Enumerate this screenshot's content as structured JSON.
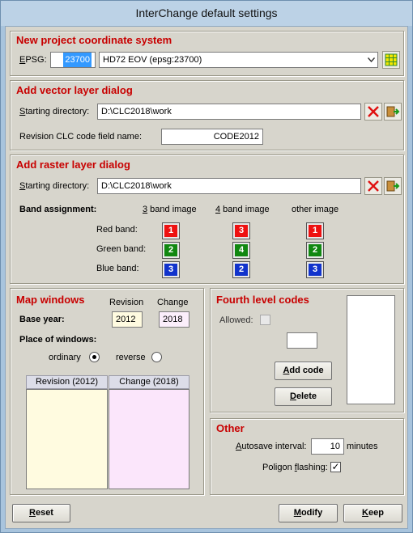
{
  "window": {
    "title": "InterChange default settings"
  },
  "project": {
    "title": "New project coordinate system",
    "epsg_prefix": "E",
    "epsg_rest": "PSG:",
    "epsg_value": "23700",
    "crs_selected": "HD72 EOV (epsg:23700)",
    "icons": {
      "grid": "grid-icon",
      "dropdown": "chevron-down-icon"
    }
  },
  "vector": {
    "title": "Add vector layer dialog",
    "start_dir_prefix": "S",
    "start_dir_rest": "tarting directory:",
    "start_dir_value": "D:\\CLC2018\\work",
    "field_label": "Revision CLC code field name:",
    "field_value": "CODE2012"
  },
  "raster": {
    "title": "Add raster layer dialog",
    "start_dir_prefix": "S",
    "start_dir_rest": "tarting directory:",
    "start_dir_value": "D:\\CLC2018\\work",
    "band_assignment": "Band assignment:",
    "columns": [
      {
        "ul": "3",
        "rest": " band image"
      },
      {
        "ul": "4",
        "rest": " band image"
      },
      {
        "ul": "",
        "rest": "other image"
      }
    ],
    "rows": [
      {
        "label": "Red band:",
        "values": [
          "1",
          "3",
          "1"
        ],
        "color": "#ee1111"
      },
      {
        "label": "Green band:",
        "values": [
          "2",
          "4",
          "2"
        ],
        "color": "#118811"
      },
      {
        "label": "Blue band:",
        "values": [
          "3",
          "2",
          "3"
        ],
        "color": "#1133cc"
      }
    ]
  },
  "map": {
    "title": "Map windows",
    "revision_label": "Revision",
    "change_label": "Change",
    "base_year_label": "Base year:",
    "revision_year": "2012",
    "change_year": "2018",
    "place_label": "Place of windows:",
    "ordinary_label": "ordinary",
    "reverse_label": "reverse",
    "ordinary_selected": true,
    "col_revision": "Revision (2012)",
    "col_change": "Change (2018)"
  },
  "fourth": {
    "title": "Fourth level codes",
    "allowed_label": "Allowed:",
    "code_value": "",
    "add_label_ul": "A",
    "add_label_rest": "dd code",
    "delete_label_ul": "D",
    "delete_label_rest": "elete"
  },
  "other": {
    "title": "Other",
    "autosave_ul": "A",
    "autosave_rest": "utosave interval:",
    "autosave_value": "10",
    "minutes": "minutes",
    "poligon_prefix": "Poligon ",
    "poligon_ul": "f",
    "poligon_rest": "lashing:",
    "poligon_checked": "✓"
  },
  "footer": {
    "reset_ul": "R",
    "reset_rest": "eset",
    "modify_ul": "M",
    "modify_rest": "odify",
    "keep_ul": "K",
    "keep_rest": "eep"
  }
}
